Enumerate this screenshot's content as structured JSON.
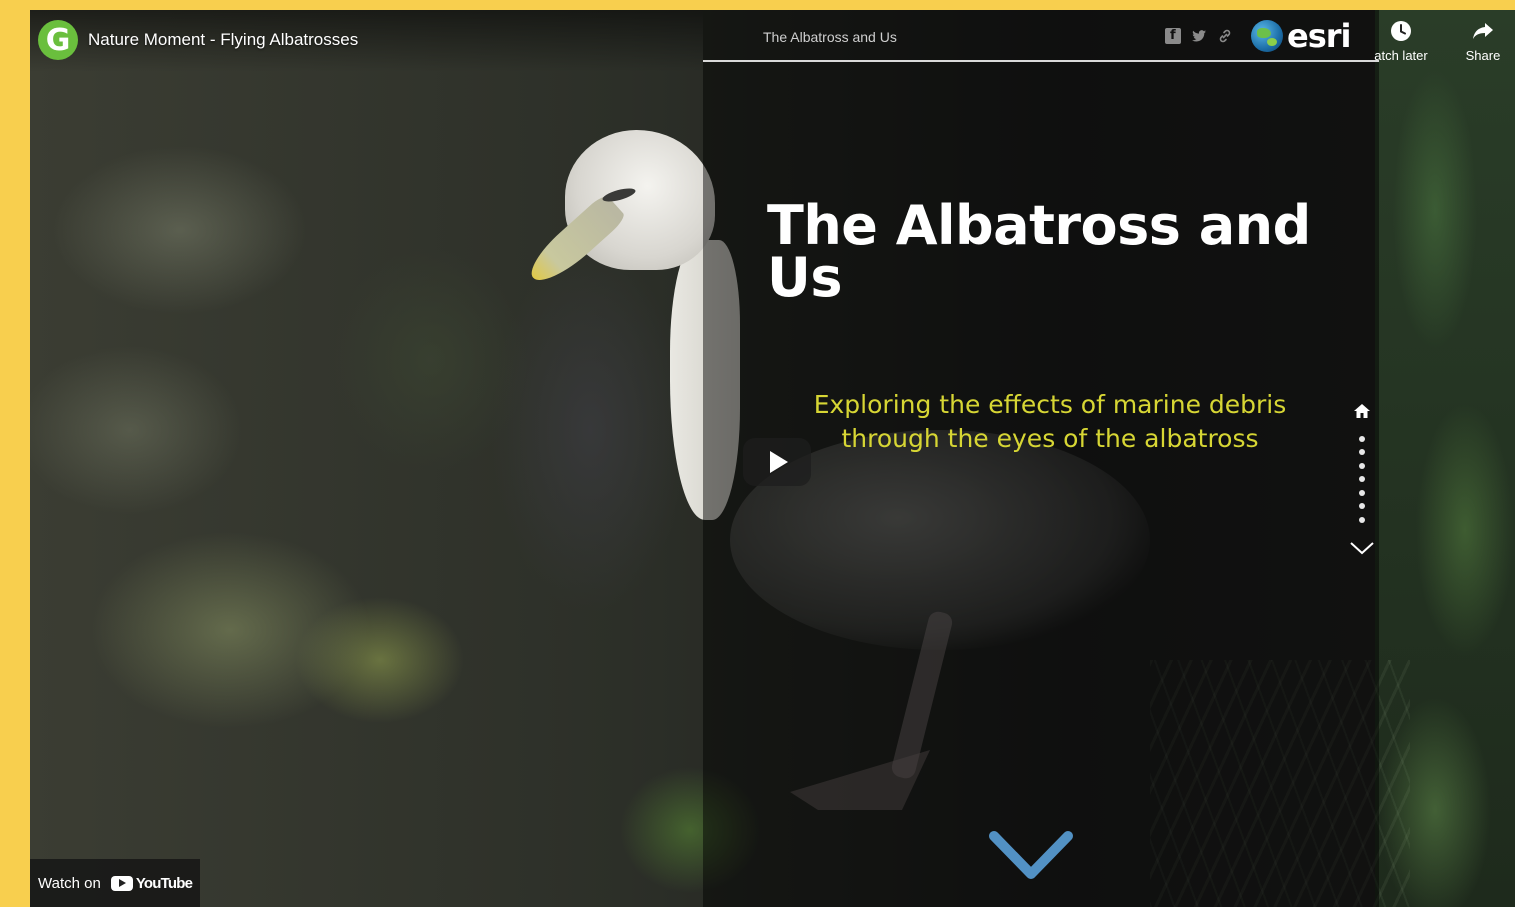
{
  "youtube": {
    "channel_avatar_letter": "G",
    "video_title": "Nature Moment - Flying Albatrosses",
    "watch_later_label": "atch later",
    "share_label": "Share",
    "watch_on_label": "Watch on",
    "youtube_logo_text": "YouTube"
  },
  "story": {
    "header_title": "The Albatross and Us",
    "brand": "esri",
    "title": "The Albatross and Us",
    "subtitle": "Exploring the effects of marine debris through the eyes of the albatross",
    "nav_dot_count": 7,
    "share_icons": [
      "facebook-icon",
      "twitter-icon",
      "link-icon"
    ]
  },
  "colors": {
    "page_border": "#f8cf4e",
    "subtitle": "#d7d634",
    "chevron": "#5aa0d8",
    "channel_avatar": "#6abf3d"
  }
}
